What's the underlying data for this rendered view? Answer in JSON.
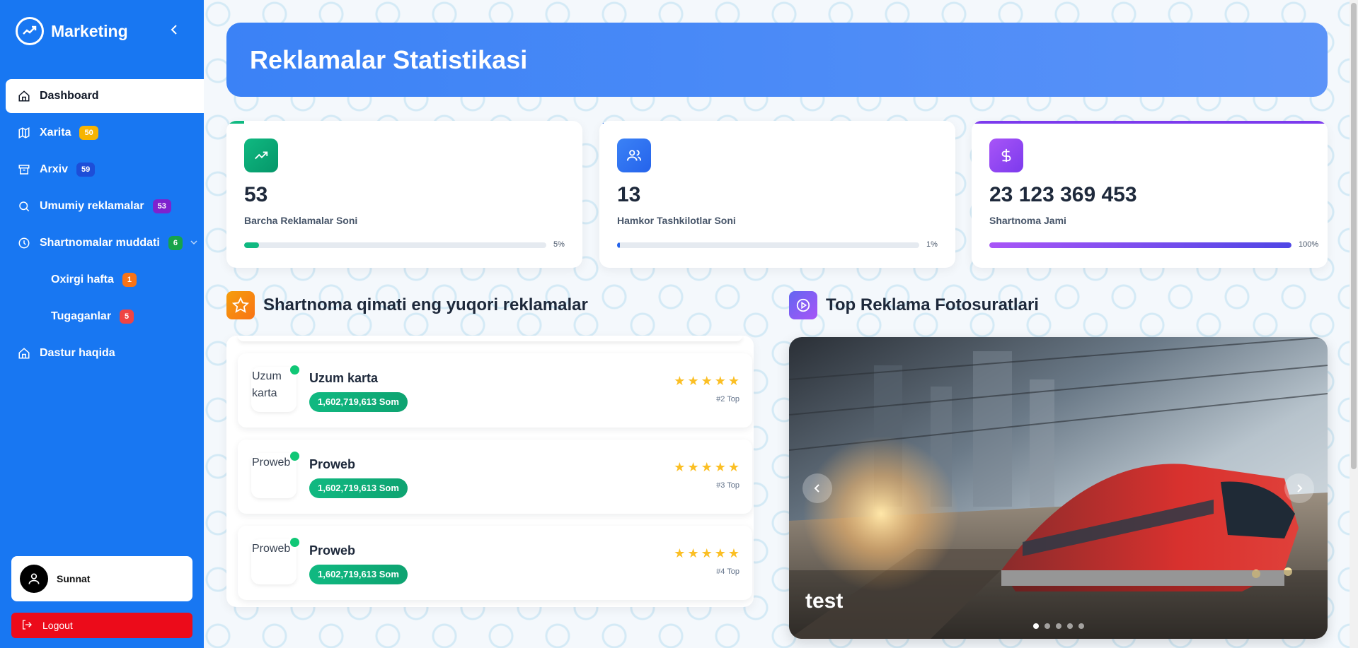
{
  "app": {
    "title": "Marketing"
  },
  "sidebar": {
    "items": [
      {
        "label": "Dashboard",
        "icon": "home-icon",
        "active": true
      },
      {
        "label": "Xarita",
        "icon": "map-icon",
        "badge": "50",
        "badge_color": "#f7b401"
      },
      {
        "label": "Arxiv",
        "icon": "archive-icon",
        "badge": "59",
        "badge_color": "#1d4ed8"
      },
      {
        "label": "Umumiy reklamalar",
        "icon": "search-icon",
        "badge": "53",
        "badge_color": "#7e22ce"
      },
      {
        "label": "Shartnomalar muddati",
        "icon": "clock-icon",
        "badge": "6",
        "badge_color": "#16a34a"
      },
      {
        "label": "Oxirgi hafta",
        "badge": "1",
        "badge_color": "#f97316"
      },
      {
        "label": "Tugaganlar",
        "badge": "5",
        "badge_color": "#ef4444"
      },
      {
        "label": "Dastur haqida",
        "icon": "home-icon"
      }
    ],
    "user": {
      "name": "Sunnat"
    },
    "logout_label": "Logout"
  },
  "header": {
    "title": "Reklamalar Statistikasi"
  },
  "stats": [
    {
      "value": "53",
      "label": "Barcha Reklamalar Soni",
      "percent": 5,
      "percent_label": "5%",
      "color": "#10b981"
    },
    {
      "value": "13",
      "label": "Hamkor Tashkilotlar Soni",
      "percent": 1,
      "percent_label": "1%",
      "color": "#2563eb"
    },
    {
      "value": "23 123 369 453",
      "label": "Shartnoma Jami",
      "percent": 100,
      "percent_label": "100%",
      "color": "#7c3aed"
    }
  ],
  "top_list": {
    "title": "Shartnoma qimati eng yuqori reklamalar",
    "rows": [
      {
        "name": "Uzum karta",
        "thumb_alt": "Uzum karta",
        "price": "1,602,719,613 Som",
        "rank": "#2 Top",
        "stars": 5
      },
      {
        "name": "Proweb",
        "thumb_alt": "Proweb",
        "price": "1,602,719,613 Som",
        "rank": "#3 Top",
        "stars": 5
      },
      {
        "name": "Proweb",
        "thumb_alt": "Proweb",
        "price": "1,602,719,613 Som",
        "rank": "#4 Top",
        "stars": 5
      }
    ]
  },
  "photos": {
    "title": "Top Reklama Fotosuratlari",
    "caption": "test",
    "slide_count": 5,
    "active_slide": 1
  }
}
